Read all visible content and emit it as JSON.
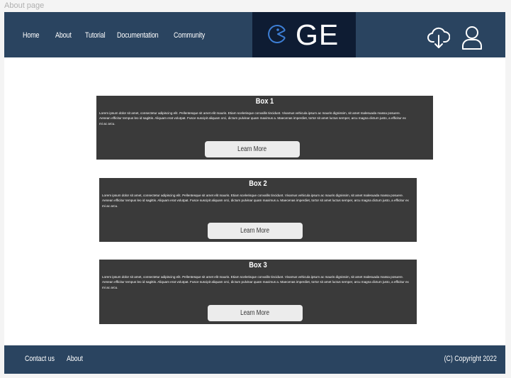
{
  "frame_label": "About  page",
  "header": {
    "nav": [
      "Home",
      "About",
      "Tutorial",
      "Documentation",
      "Community"
    ],
    "logo_text": "GE",
    "icons": [
      "cloud-download-icon",
      "user-icon"
    ]
  },
  "cards": [
    {
      "title": "Box 1",
      "body": "Lorem ipsum dolor sit amet, consectetur adipiscing elit. Pellentesque sit amet elit mauris. Etiam scelerisque convallis tincidunt. Vivamus vehicula ipsum ac mauris dignissim, sit amet malesuada massa posuere. Aenean efficitur tempus leo id sagittis. Aliquam erat volutpat. Fusce suscipit aliquam orci, dictum pulvinar quam maximus a. Maecenas imperdiet, tortor sit amet luctus semper, arcu magna dictum justo, a efficitur ex mi ac arcu.",
      "button": "Learn More"
    },
    {
      "title": "Box 2",
      "body": "Lorem ipsum dolor sit amet, consectetur adipiscing elit. Pellentesque sit amet elit mauris. Etiam scelerisque convallis tincidunt. Vivamus vehicula ipsum ac mauris dignissim, sit amet malesuada massa posuere. Aenean efficitur tempus leo id sagittis. Aliquam erat volutpat. Fusce suscipit aliquam orci, dictum pulvinar quam maximus a. Maecenas imperdiet, tortor sit amet luctus semper, arcu magna dictum justo, a efficitur ex mi ac arcu.",
      "button": "Learn More"
    },
    {
      "title": "Box 3",
      "body": "Lorem ipsum dolor sit amet, consectetur adipiscing elit. Pellentesque sit amet elit mauris. Etiam scelerisque convallis tincidunt. Vivamus vehicula ipsum ac mauris dignissim, sit amet malesuada massa posuere. Aenean efficitur tempus leo id sagittis. Aliquam erat volutpat. Fusce suscipit aliquam orci, dictum pulvinar quam maximus a. Maecenas imperdiet, tortor sit amet luctus semper, arcu magna dictum justo, a efficitur ex mi ac arcu.",
      "button": "Learn More"
    }
  ],
  "footer": {
    "links": [
      "Contact us",
      "About"
    ],
    "copyright": "(C) Copyright 2022"
  },
  "colors": {
    "header_bg": "#2a4460",
    "logo_bg": "#0e1c33",
    "card_bg": "#3a3a3a",
    "button_bg": "#ececec",
    "logo_icon": "#3d7fd6"
  }
}
